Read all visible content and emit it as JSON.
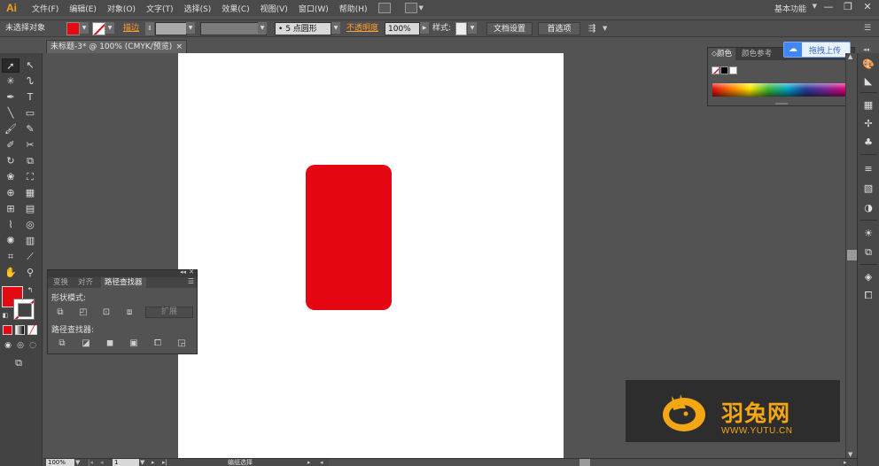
{
  "app": {
    "logo": "Ai",
    "workspace": "基本功能"
  },
  "menu": [
    "文件(F)",
    "编辑(E)",
    "对象(O)",
    "文字(T)",
    "选择(S)",
    "效果(C)",
    "视图(V)",
    "窗口(W)",
    "帮助(H)"
  ],
  "window_controls": {
    "minimize": "—",
    "restore": "❐",
    "close": "✕"
  },
  "control_bar": {
    "selection_status": "未选择对象",
    "fill_color": "#e30a14",
    "stroke_label": "描边",
    "brush_value": "5 点圆形",
    "brush_dot": "•",
    "opacity_label": "不透明度",
    "opacity_value": "100%",
    "style_label": "样式:",
    "doc_setup_button": "文档设置",
    "preferences_button": "首选项"
  },
  "document_tab": {
    "title": "未标题-3* @ 100% (CMYK/预览)",
    "close": "×"
  },
  "tools": {
    "fill_color": "#e30a14",
    "stroke_color": "#ffffff",
    "icons": [
      "selection-tool",
      "direct-selection-tool",
      "magic-wand-tool",
      "lasso-tool",
      "pen-tool",
      "type-tool",
      "line-tool",
      "rectangle-tool",
      "paintbrush-tool",
      "pencil-tool",
      "blob-brush-tool",
      "eraser-tool",
      "rotate-tool",
      "scale-tool",
      "warp-tool",
      "free-transform-tool",
      "shape-builder-tool",
      "perspective-grid-tool",
      "mesh-tool",
      "gradient-tool",
      "eyedropper-tool",
      "blend-tool",
      "symbol-sprayer-tool",
      "column-graph-tool",
      "artboard-tool",
      "slice-tool",
      "hand-tool",
      "zoom-tool"
    ]
  },
  "artboard": {
    "shape_color": "#e40613"
  },
  "color_panel": {
    "tabs": [
      "颜色",
      "颜色参考"
    ],
    "active_tab": "颜色",
    "swatches": [
      "#ffffff",
      "#000000",
      "#ffffff"
    ]
  },
  "upload_button": {
    "label": "拖拽上传"
  },
  "pathfinder_panel": {
    "tabs": [
      "变换",
      "对齐",
      "路径查找器"
    ],
    "active_tab": "路径查找器",
    "shape_modes_label": "形状模式:",
    "expand_button": "扩展",
    "pathfinders_label": "路径查找器:"
  },
  "status_bar": {
    "zoom": "100%",
    "artboard_number": "1",
    "status_text": "编组选择"
  },
  "watermark": {
    "name": "羽兔网",
    "url": "WWW.YUTU.CN",
    "color": "#f5a615"
  }
}
